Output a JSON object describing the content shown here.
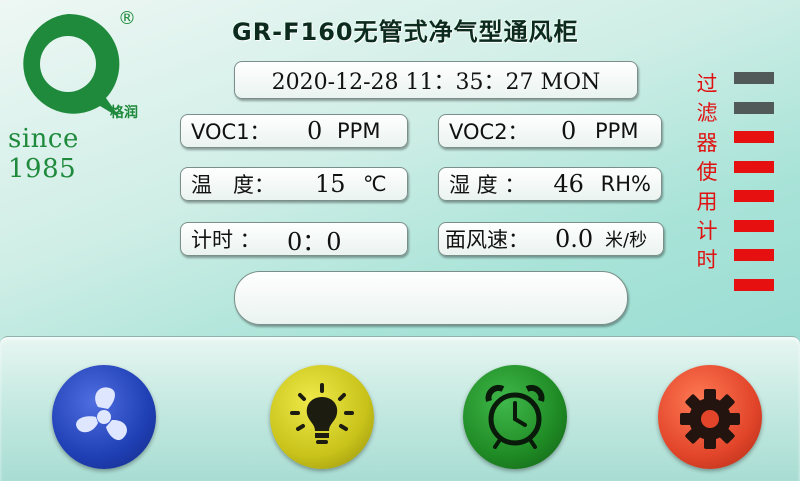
{
  "brand": {
    "registered_mark": "®",
    "logo_text": "格润",
    "since": "since 1985"
  },
  "header": {
    "title": "GR-F160无管式净气型通风柜"
  },
  "status": {
    "datetime": "2020-12-28 11：35：27 MON",
    "voc1": {
      "label": "VOC1：",
      "value": "0",
      "unit": "PPM"
    },
    "voc2": {
      "label": "VOC2：",
      "value": "0",
      "unit": "PPM"
    },
    "temperature": {
      "label": "温　度：",
      "value": "15",
      "unit": "℃"
    },
    "humidity": {
      "label": "湿 度 ：",
      "value": "46",
      "unit": "RH%"
    },
    "timer": {
      "label": "计时 ：",
      "value": "0：0"
    },
    "face_velocity": {
      "label": "面风速：",
      "value": "0.0",
      "unit": "米/秒"
    },
    "message": ""
  },
  "filter_usage": {
    "label_chars": [
      "过",
      "滤",
      "器",
      "使",
      "用",
      "计",
      "时"
    ],
    "bars": [
      "off",
      "off",
      "on",
      "on",
      "on",
      "on",
      "on",
      "on"
    ]
  },
  "dock": {
    "buttons": [
      {
        "name": "fan-button",
        "icon": "fan-icon",
        "color": "#1f3fb5"
      },
      {
        "name": "light-button",
        "icon": "lightbulb-icon",
        "color": "#c8c21a"
      },
      {
        "name": "alarm-button",
        "icon": "alarm-clock-icon",
        "color": "#1f8a24"
      },
      {
        "name": "settings-button",
        "icon": "gear-icon",
        "color": "#e2452a"
      }
    ]
  },
  "colors": {
    "accent_red": "#e61010",
    "bar_off": "#515a58",
    "logo_green": "#1f8a3c"
  }
}
